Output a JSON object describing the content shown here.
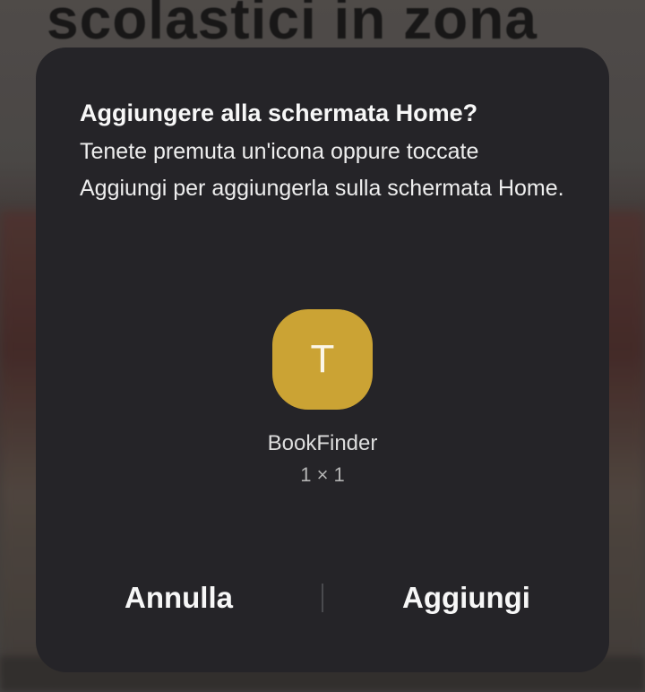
{
  "background": {
    "partial_title": "scolastici in zona"
  },
  "dialog": {
    "title": "Aggiungere alla schermata Home?",
    "message": "Tenete premuta un'icona oppure toccate Aggiungi per aggiungerla sulla schermata Home.",
    "app": {
      "icon_letter": "T",
      "icon_color": "#cba334",
      "name": "BookFinder",
      "size": "1 × 1"
    },
    "buttons": {
      "cancel_label": "Annulla",
      "add_label": "Aggiungi"
    },
    "background_color": "#252428"
  }
}
